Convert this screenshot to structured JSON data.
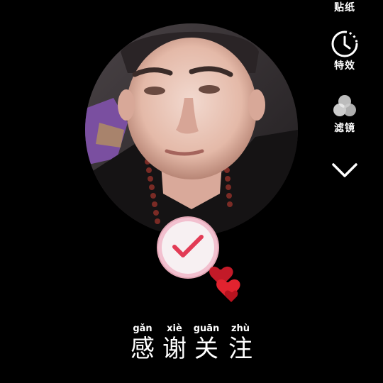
{
  "toolbar": {
    "stickers_label": "贴纸",
    "effects_label": "特效",
    "filters_label": "滤镜",
    "more_icon": "chevron-down-icon"
  },
  "avatar": {
    "icon": "profile-photo"
  },
  "badge": {
    "icon": "checkmark-icon",
    "accent": "#e23b55",
    "ring": "#f2c0cf"
  },
  "caption": {
    "chars": [
      {
        "hanzi": "感",
        "pinyin": "gǎn"
      },
      {
        "hanzi": "谢",
        "pinyin": "xiè"
      },
      {
        "hanzi": "关",
        "pinyin": "guān"
      },
      {
        "hanzi": "注",
        "pinyin": "zhù"
      }
    ]
  },
  "colors": {
    "background": "#000000",
    "text": "#ffffff"
  }
}
